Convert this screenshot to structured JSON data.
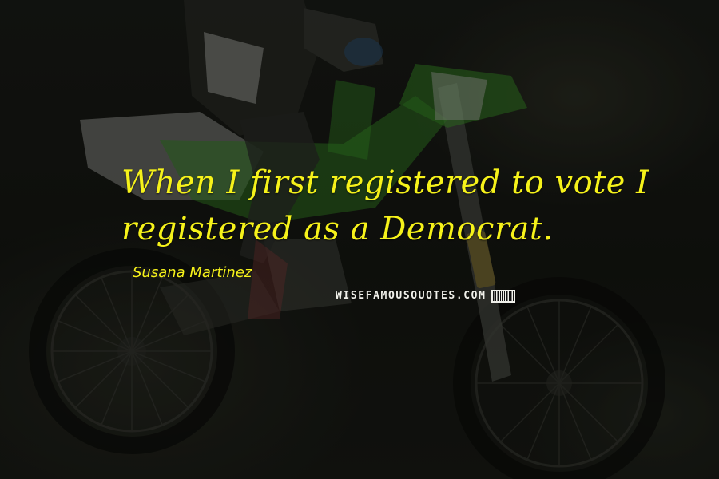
{
  "quote": {
    "line1": "When I first registered to vote I",
    "line2": "registered as a Democrat."
  },
  "author": "Susana Martinez",
  "watermark": {
    "text": "WISEFAMOUSQUOTES.COM"
  },
  "colors": {
    "quote_text": "#f6f21a",
    "background": "#151712",
    "bike_green": "#3fa52b"
  },
  "image": {
    "subject_icon": "motocross-rider-icon"
  }
}
